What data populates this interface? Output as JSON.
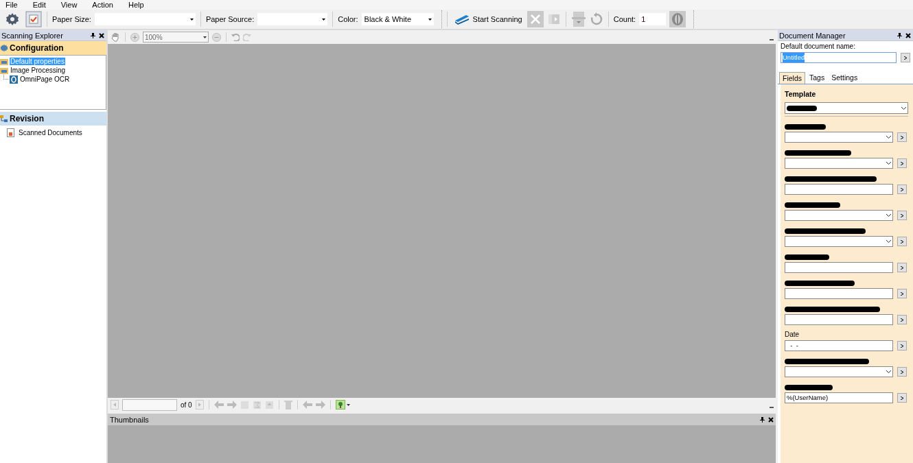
{
  "menu": [
    "File",
    "Edit",
    "View",
    "Action",
    "Help"
  ],
  "toolbar": {
    "paper_size": {
      "label": "Paper Size:"
    },
    "paper_source": {
      "label": "Paper Source:"
    },
    "color": {
      "label": "Color:",
      "value": "Black & White"
    },
    "start_button": "Start Scanning",
    "count": {
      "label": "Count:",
      "value": "1"
    }
  },
  "explorer": {
    "title": "Scanning Explorer",
    "configuration": {
      "title": "Configuration",
      "items": [
        {
          "label": "Default properties",
          "selected": true
        },
        {
          "label": "Image Processing",
          "selected": false,
          "children": [
            {
              "label": "OmniPage OCR",
              "selected": false
            }
          ]
        }
      ]
    },
    "revision": {
      "title": "Revision",
      "items": [
        {
          "label": "Scanned Documents"
        }
      ]
    }
  },
  "viewer": {
    "zoom": "100%",
    "page_of": "of 0",
    "thumbnails_title": "Thumbnails"
  },
  "document_manager": {
    "title": "Document Manager",
    "name_label": "Default document name:",
    "name_value": "Untitled",
    "tabs": [
      {
        "label": "Fields",
        "selected": true
      },
      {
        "label": "Tags",
        "selected": false
      },
      {
        "label": "Settings",
        "selected": false
      }
    ],
    "template_label": "Template",
    "fields": [
      {
        "kind": "dropdown",
        "redacted": true
      },
      {
        "kind": "dropdown",
        "redacted": true
      },
      {
        "kind": "text",
        "redacted": true
      },
      {
        "kind": "dropdown",
        "redacted": true
      },
      {
        "kind": "dropdown",
        "redacted": true
      },
      {
        "kind": "text",
        "redacted": true
      },
      {
        "kind": "text",
        "redacted": true
      },
      {
        "kind": "text",
        "redacted": true
      },
      {
        "kind": "text",
        "redacted": false,
        "label": "Date",
        "value": "  -  -"
      },
      {
        "kind": "dropdown",
        "redacted": true
      },
      {
        "kind": "text",
        "redacted": true,
        "value": "%(UserName)"
      }
    ]
  }
}
